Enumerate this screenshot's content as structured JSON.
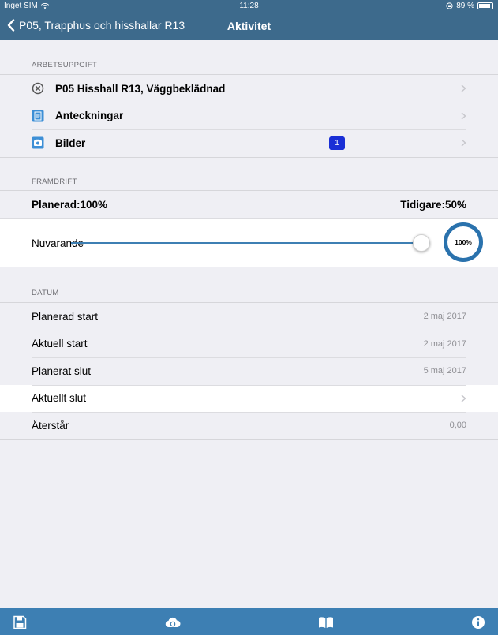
{
  "status_bar": {
    "carrier": "Inget SIM",
    "time": "11:28",
    "battery": "89 %"
  },
  "nav": {
    "back_label": "P05, Trapphus och hisshallar R13",
    "title": "Aktivitet"
  },
  "task_section": {
    "header": "ARBETSUPPGIFT",
    "items": [
      {
        "label": "P05 Hisshall R13, Väggbeklädnad",
        "icon": "cancel-circle-icon"
      },
      {
        "label": "Anteckningar",
        "icon": "notes-icon"
      },
      {
        "label": "Bilder",
        "icon": "camera-icon",
        "badge": "1"
      }
    ]
  },
  "progress_section": {
    "header": "FRAMDRIFT",
    "planned": "Planerad:100%",
    "previous": "Tidigare:50%",
    "current_label": "Nuvarande",
    "current_value": 1.0,
    "current_text": "100%"
  },
  "date_section": {
    "header": "DATUM",
    "rows": [
      {
        "label": "Planerad start",
        "value": "2 maj 2017"
      },
      {
        "label": "Aktuell start",
        "value": "2 maj 2017"
      },
      {
        "label": "Planerat slut",
        "value": "5 maj 2017"
      },
      {
        "label": "Aktuellt slut",
        "value": ""
      },
      {
        "label": "Återstår",
        "value": "0,00"
      }
    ]
  },
  "colors": {
    "bar": "#3d6a8c",
    "toolbar": "#3d7fb3",
    "accent": "#2a72ad",
    "badge": "#1a2fd6"
  },
  "toolbar": {
    "icons": [
      "save-icon",
      "cloud-sync-icon",
      "book-icon",
      "info-icon"
    ]
  }
}
